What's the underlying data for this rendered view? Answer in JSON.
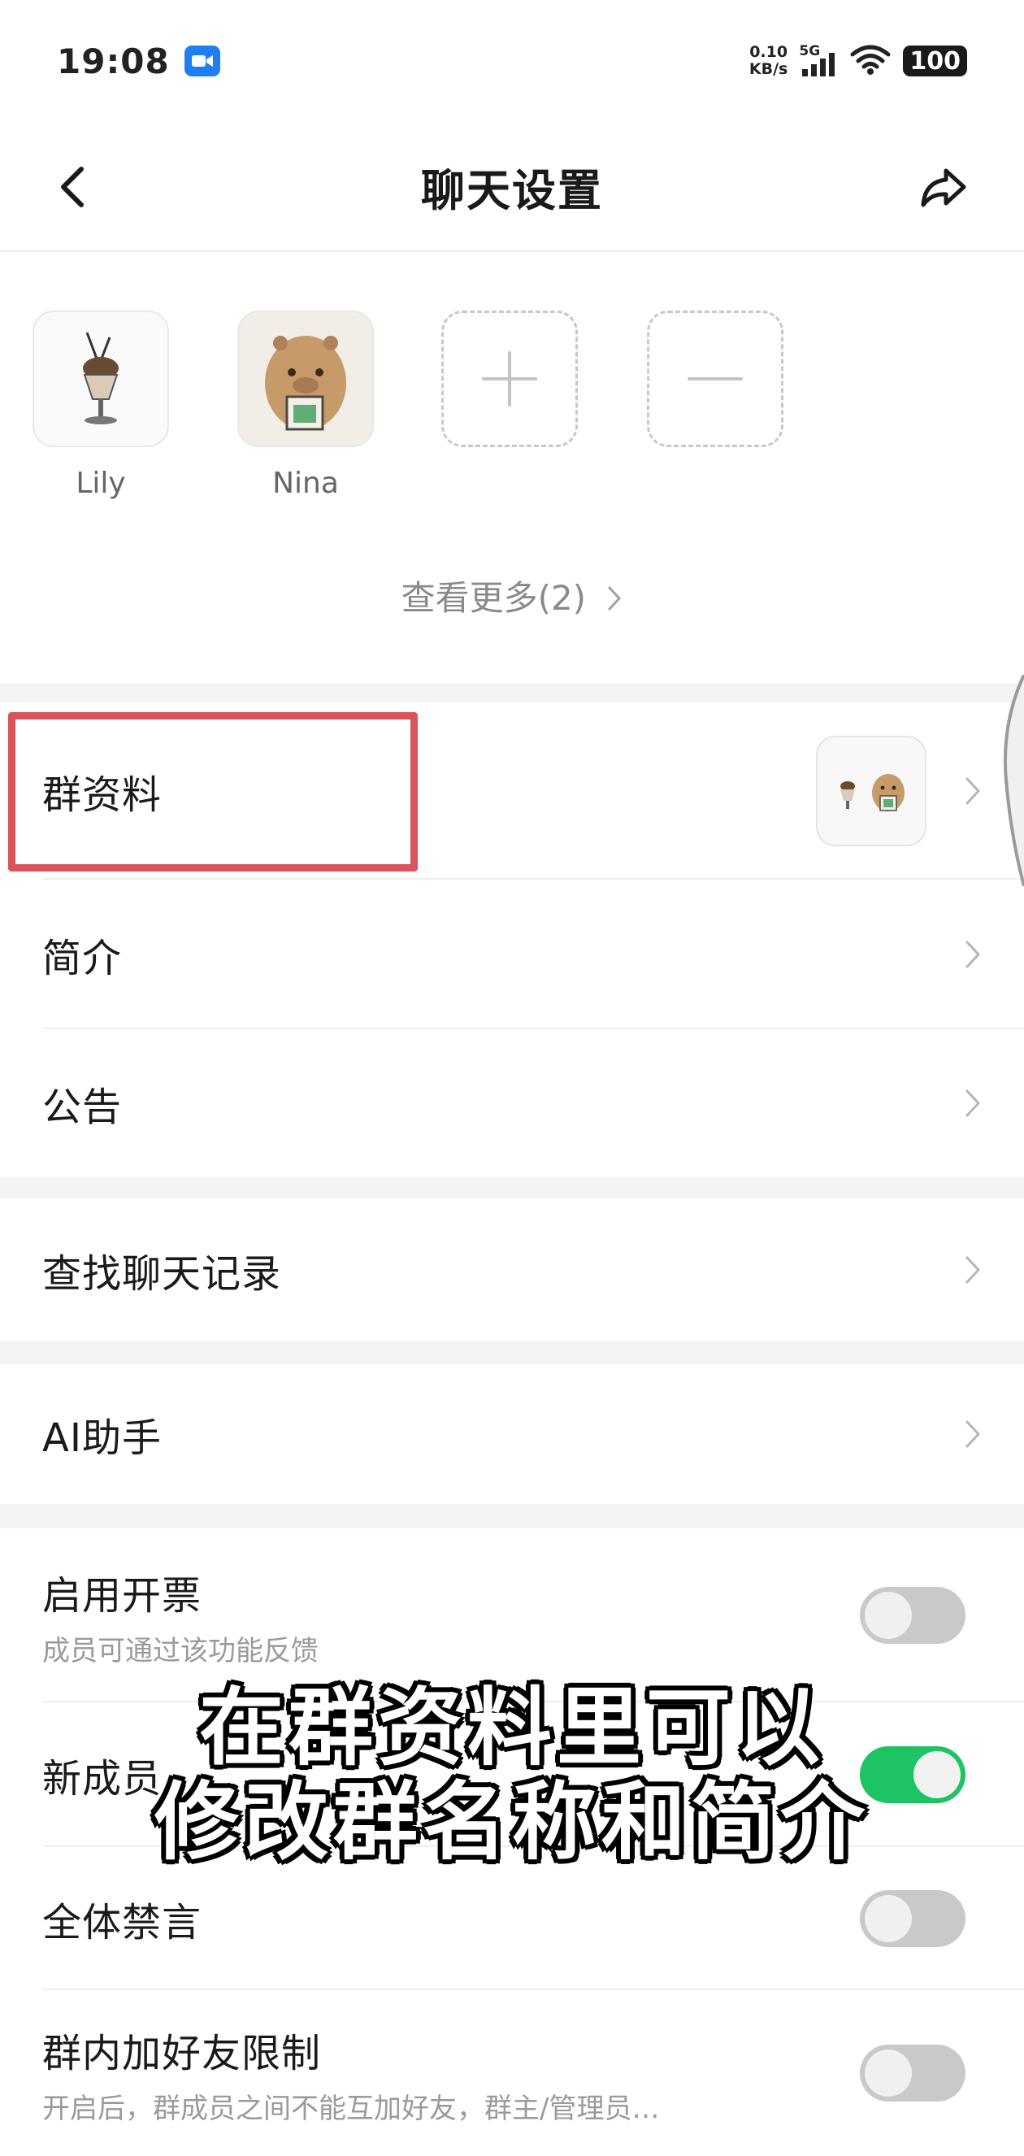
{
  "status_bar": {
    "time": "19:08",
    "net_speed_value": "0.10",
    "net_speed_unit": "KB/s",
    "network_type": "5G",
    "battery": "100"
  },
  "nav": {
    "title": "聊天设置"
  },
  "members": {
    "items": [
      {
        "name": "Lily"
      },
      {
        "name": "Nina"
      }
    ],
    "view_more": "查看更多(2)"
  },
  "menu": {
    "group_profile": "群资料",
    "intro": "简介",
    "announcement": "公告",
    "search_history": "查找聊天记录",
    "ai_assistant": "AI助手"
  },
  "settings": {
    "enable_ticket": {
      "label": "启用开票",
      "sub": "成员可通过该功能反馈",
      "enabled": false
    },
    "new_member": {
      "label": "新成员",
      "enabled": true
    },
    "mute_all": {
      "label": "全体禁言",
      "enabled": false
    },
    "friend_limit": {
      "label": "群内加好友限制",
      "sub": "开启后，群成员之间不能互加好友，群主/管理员…",
      "enabled": false
    }
  },
  "caption": {
    "line1": "在群资料里可以",
    "line2": "修改群名称和简介"
  },
  "colors": {
    "highlight": "#d9545b",
    "toggle_on": "#1ec463",
    "toggle_off": "#c9c9c9"
  }
}
